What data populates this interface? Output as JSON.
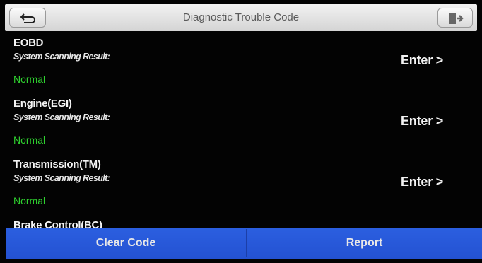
{
  "header": {
    "title": "Diagnostic Trouble Code",
    "back_icon": "back-arrow-icon",
    "exit_icon": "exit-icon"
  },
  "systems": [
    {
      "name": "EOBD",
      "subtitle": "System Scanning Result:",
      "status": "Normal",
      "action": "Enter >"
    },
    {
      "name": "Engine(EGI)",
      "subtitle": "System Scanning Result:",
      "status": "Normal",
      "action": "Enter >"
    },
    {
      "name": "Transmission(TM)",
      "subtitle": "System Scanning Result:",
      "status": "Normal",
      "action": "Enter >"
    },
    {
      "name": "Brake Control(BC)"
    }
  ],
  "footer": {
    "clear_label": "Clear Code",
    "report_label": "Report"
  },
  "colors": {
    "background": "#030303",
    "status_ok": "#2fd12f",
    "footer_bar": "#2755d8"
  }
}
